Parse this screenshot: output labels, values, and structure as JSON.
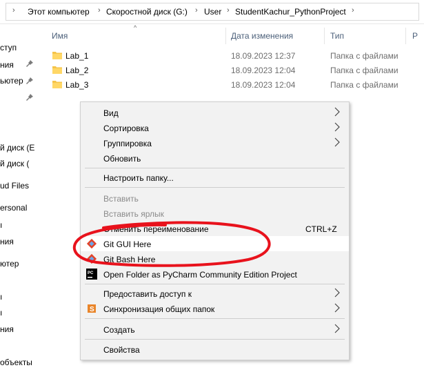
{
  "address": {
    "crumbs": [
      "Этот компьютер",
      "Скоростной диск (G:)",
      "User",
      "StudentKachur_PythonProject"
    ]
  },
  "nav": {
    "items": [
      "ступ",
      "ния",
      "ьютер",
      "й диск (E",
      "й диск (",
      "ud Files",
      "ersonal",
      "",
      "ния",
      "ютер",
      "",
      "",
      "ния",
      "объекты"
    ]
  },
  "columns": {
    "name": "Имя",
    "date": "Дата изменения",
    "type": "Тип",
    "size": "Р"
  },
  "files": [
    {
      "name": "Lab_1",
      "date": "18.09.2023 12:37",
      "type": "Папка с файлами"
    },
    {
      "name": "Lab_2",
      "date": "18.09.2023 12:04",
      "type": "Папка с файлами"
    },
    {
      "name": "Lab_3",
      "date": "18.09.2023 12:04",
      "type": "Папка с файлами"
    }
  ],
  "menu": {
    "view": "Вид",
    "sort": "Сортировка",
    "group": "Группировка",
    "refresh": "Обновить",
    "customize": "Настроить папку...",
    "paste": "Вставить",
    "paste_shortcut": "Вставить ярлык",
    "undo_rename": "Отменить переименование",
    "undo_shortcut": "CTRL+Z",
    "git_gui": "Git GUI Here",
    "git_bash": "Git Bash Here",
    "pycharm": "Open Folder as PyCharm Community Edition Project",
    "give_access": "Предоставить доступ к",
    "sync": "Синхронизация общих папок",
    "create": "Создать",
    "properties": "Свойства"
  },
  "colors": {
    "highlight_annotation": "#e8121c",
    "folder": "#f5c44a",
    "git": "#e24329"
  }
}
